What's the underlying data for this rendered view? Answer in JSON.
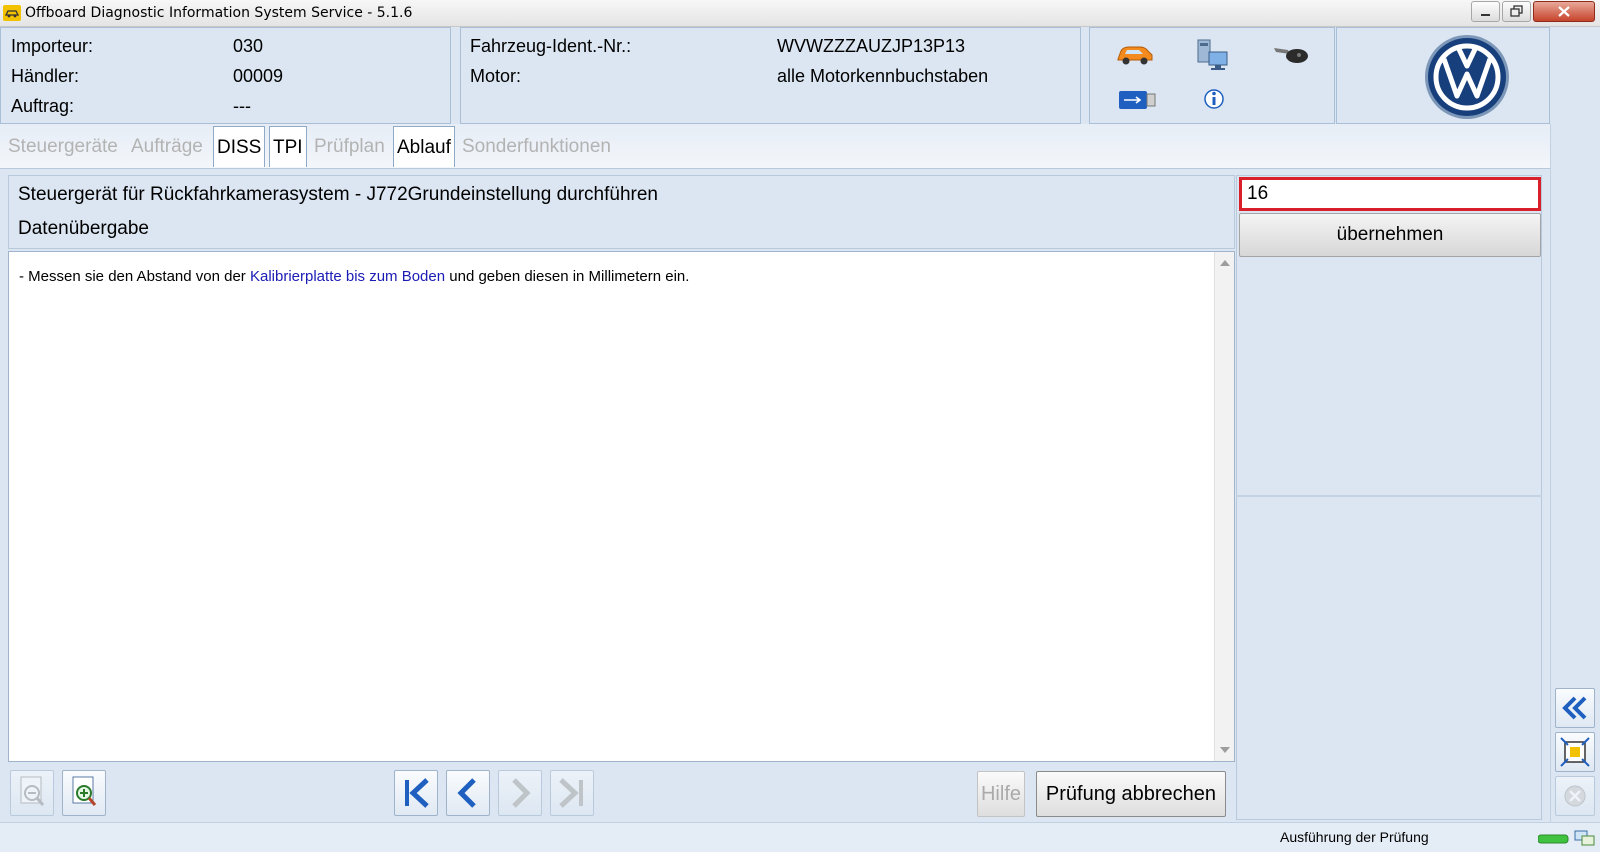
{
  "window": {
    "title": "Offboard Diagnostic Information System Service - 5.1.6"
  },
  "header": {
    "importeur_label": "Importeur:",
    "importeur_value": "030",
    "haendler_label": "Händler:",
    "haendler_value": "00009",
    "auftrag_label": "Auftrag:",
    "auftrag_value": "---",
    "fin_label": "Fahrzeug-Ident.-Nr.:",
    "fin_value": "WVWZZZAUZJP13P13",
    "motor_label": "Motor:",
    "motor_value": "alle Motorkennbuchstaben"
  },
  "header_icons": [
    "car-icon",
    "network-computer-icon",
    "key-icon",
    "usb-icon",
    "info-icon"
  ],
  "tabs": [
    {
      "label": "Steuergeräte",
      "active": false
    },
    {
      "label": "Aufträge",
      "active": false
    },
    {
      "label": "DISS",
      "active": true
    },
    {
      "label": "TPI",
      "active": true
    },
    {
      "label": "Prüfplan",
      "active": false
    },
    {
      "label": "Ablauf",
      "active": true
    },
    {
      "label": "Sonderfunktionen",
      "active": false
    }
  ],
  "main": {
    "title": "Steuergerät für Rückfahrkamerasystem - J772Grundeinstellung durchführen",
    "subtitle": "Datenübergabe",
    "instruction_prefix": "- Messen sie den Abstand von der ",
    "instruction_link": "Kalibrierplatte bis zum Boden",
    "instruction_suffix": " und geben diesen in Millimetern ein."
  },
  "input": {
    "value": "16",
    "accept_label": "übernehmen"
  },
  "toolbar": {
    "help_label": "Hilfe",
    "abort_label": "Prüfung abbrechen"
  },
  "status": {
    "text": "Ausführung der Prüfung"
  },
  "colors": {
    "background": "#dbe6f2",
    "input_border": "#d9202a",
    "link": "#1b1bb5",
    "nav_blue": "#1f5fbf"
  }
}
